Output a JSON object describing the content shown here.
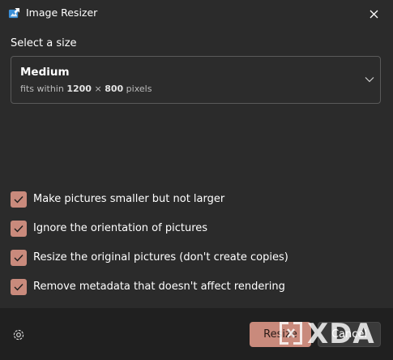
{
  "window": {
    "title": "Image Resizer",
    "app_icon": "image-resizer-icon",
    "close_icon": "close-icon"
  },
  "size_section": {
    "label": "Select a size",
    "selected": {
      "name": "Medium",
      "desc_prefix": "fits within",
      "width": "1200",
      "times": "×",
      "height": "800",
      "unit": "pixels"
    },
    "dropdown_icon": "chevron-down-icon"
  },
  "options": [
    {
      "label": "Make pictures smaller but not larger",
      "checked": true
    },
    {
      "label": "Ignore the orientation of pictures",
      "checked": true
    },
    {
      "label": "Resize the original pictures (don't create copies)",
      "checked": true
    },
    {
      "label": "Remove metadata that doesn't affect rendering",
      "checked": true
    }
  ],
  "footer": {
    "settings_icon": "gear-icon",
    "resize_label": "Resize",
    "cancel_label": "Cancel"
  },
  "watermark": {
    "text": "XDA"
  },
  "colors": {
    "accent": "#c98a7c",
    "background": "#2b2b2b",
    "footer": "#202020"
  }
}
